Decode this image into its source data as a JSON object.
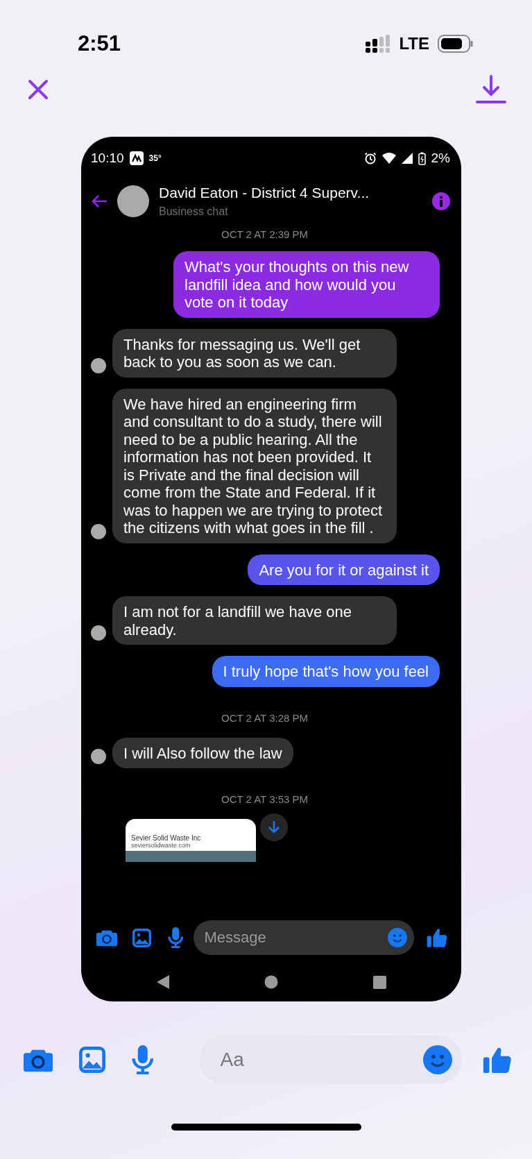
{
  "status_bar": {
    "time": "2:51",
    "network": "LTE"
  },
  "screenshot": {
    "status_bar": {
      "time": "10:10",
      "temperature": "35°",
      "battery": "2%"
    },
    "header": {
      "name": "David Eaton - District 4 Superv...",
      "subtitle": "Business chat"
    },
    "messages": [
      {
        "kind": "timestamp",
        "text": "OCT 2 AT 2:39 PM"
      },
      {
        "kind": "outgoing",
        "text": "What's your thoughts on this new landfill idea and how would you vote on it today",
        "color": "#8a2be2"
      },
      {
        "kind": "incoming",
        "text": "Thanks for messaging us. We'll get back to you as soon as we can."
      },
      {
        "kind": "incoming",
        "text": "We have hired an engineering firm and consultant to do a study, there will need to be a public hearing. All the information has not been provided. It is Private and the final decision will come from the State and Federal. If it was to happen we are trying to protect the citizens with what goes in the fill ."
      },
      {
        "kind": "outgoing",
        "text": "Are you for it or against it",
        "color": "#5755ee"
      },
      {
        "kind": "incoming",
        "text": "I am not for a landfill we have one already."
      },
      {
        "kind": "outgoing",
        "text": "I truly hope that's how you feel",
        "color": "#3c6cf2"
      },
      {
        "kind": "timestamp",
        "text": "OCT 2 AT 3:28 PM"
      },
      {
        "kind": "incoming",
        "text": "I will Also follow the law"
      },
      {
        "kind": "timestamp",
        "text": "OCT 2 AT 3:53 PM"
      },
      {
        "kind": "attachment",
        "title": "Sevier Solid Waste Inc",
        "url": "seviersolidwaste.com"
      }
    ],
    "composer": {
      "placeholder": "Message"
    }
  },
  "composer": {
    "placeholder": "Aa"
  }
}
